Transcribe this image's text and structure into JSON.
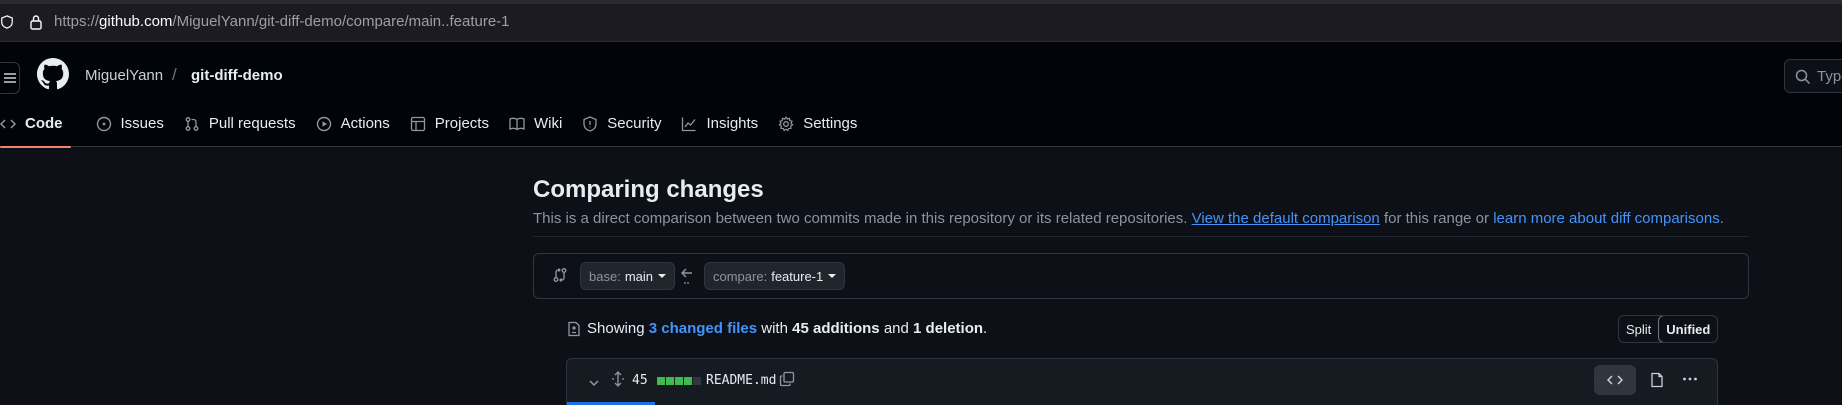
{
  "browser": {
    "url_prefix": "https://",
    "url_host": "github.com",
    "url_path": "/MiguelYann/git-diff-demo/compare/main..feature-1"
  },
  "header": {
    "owner": "MiguelYann",
    "separator": "/",
    "repo": "git-diff-demo",
    "search_placeholder": "Type"
  },
  "tabs": [
    {
      "label": "Code",
      "icon": "code-icon",
      "active": true
    },
    {
      "label": "Issues",
      "icon": "issue-icon"
    },
    {
      "label": "Pull requests",
      "icon": "pull-request-icon"
    },
    {
      "label": "Actions",
      "icon": "play-icon"
    },
    {
      "label": "Projects",
      "icon": "table-icon"
    },
    {
      "label": "Wiki",
      "icon": "book-icon"
    },
    {
      "label": "Security",
      "icon": "shield-icon"
    },
    {
      "label": "Insights",
      "icon": "graph-icon"
    },
    {
      "label": "Settings",
      "icon": "gear-icon"
    }
  ],
  "main": {
    "title": "Comparing changes",
    "description_1": "This is a direct comparison between two commits made in this repository or its related repositories.",
    "link_default": "View the default comparison",
    "description_2": "for this range or",
    "link_learn": "learn more about diff comparisons",
    "description_3": "."
  },
  "range": {
    "base_key": "base:",
    "base_value": "main",
    "compare_key": "compare:",
    "compare_value": "feature-1",
    "arrow_dots": ".."
  },
  "summary": {
    "showing": "Showing",
    "changed_files": "3 changed files",
    "with": "with",
    "additions": "45 additions",
    "and": "and",
    "deletion": "1 deletion",
    "period": ".",
    "split_label": "Split",
    "unified_label": "Unified"
  },
  "file": {
    "count": "45",
    "name": "README.md",
    "diffstat": [
      "add",
      "add",
      "add",
      "add",
      "neutral"
    ]
  },
  "colors": {
    "accent_tab": "#f78166",
    "link": "#4493f8",
    "addition": "#3fb950",
    "neutral": "#30363d"
  }
}
